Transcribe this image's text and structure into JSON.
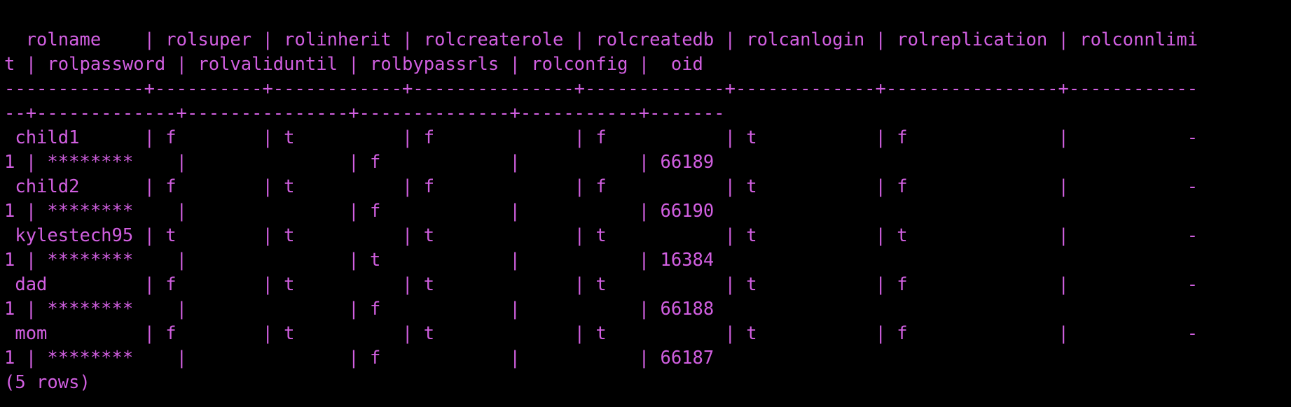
{
  "terminal": {
    "text_color": "#d15fe0",
    "background": "#000000",
    "lines": [
      "  rolname    | rolsuper | rolinherit | rolcreaterole | rolcreatedb | rolcanlogin | rolreplication | rolconnlimi",
      "t | rolpassword | rolvaliduntil | rolbypassrls | rolconfig |  oid",
      "-------------+----------+------------+---------------+-------------+-------------+----------------+------------",
      "--+-------------+---------------+--------------+-----------+-------",
      " child1      | f        | t          | f             | f           | t           | f              |           -",
      "1 | ********    |               | f            |           | 66189",
      " child2      | f        | t          | f             | f           | t           | f              |           -",
      "1 | ********    |               | f            |           | 66190",
      " kylestech95 | t        | t          | t             | t           | t           | t              |           -",
      "1 | ********    |               | t            |           | 16384",
      " dad         | f        | t          | t             | t           | t           | f              |           -",
      "1 | ********    |               | f            |           | 66188",
      " mom         | f        | t          | t             | t           | t           | f              |           -",
      "1 | ********    |               | f            |           | 66187",
      "(5 rows)"
    ]
  }
}
